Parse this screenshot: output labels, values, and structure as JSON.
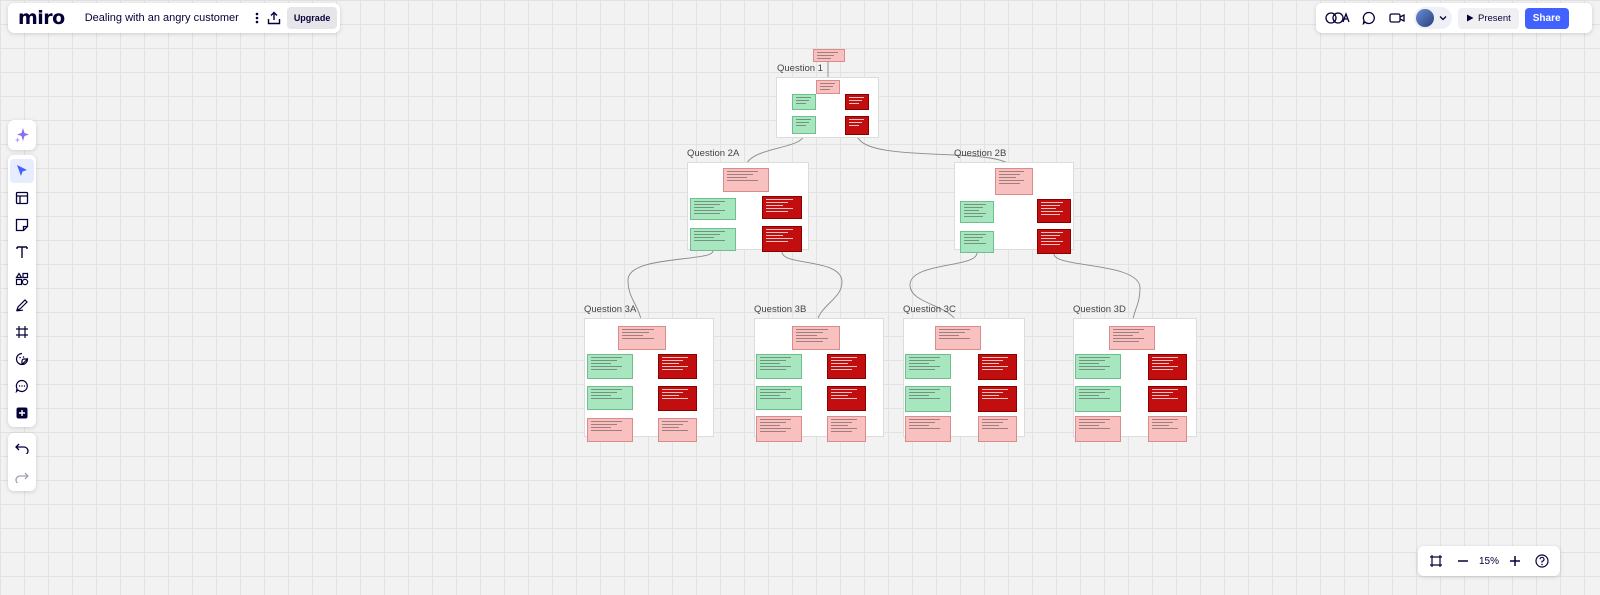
{
  "app": {
    "logo": "miro",
    "board_title": "Dealing with an angry customer",
    "upgrade_label": "Upgrade",
    "present_label": "Present",
    "share_label": "Share",
    "zoom_level": "15%"
  },
  "board": {
    "frames": [
      {
        "label": "Question 1"
      },
      {
        "label": "Question 2A"
      },
      {
        "label": "Question 2B"
      },
      {
        "label": "Question 3A"
      },
      {
        "label": "Question 3B"
      },
      {
        "label": "Question 3C"
      },
      {
        "label": "Question 3D"
      }
    ]
  },
  "icons": {
    "board": "cube-icon",
    "more": "more-vertical-icon",
    "export": "upload-icon",
    "reactions": "reactions-icon",
    "comments": "comment-icon",
    "video": "video-icon",
    "avatar_chevron": "chevron-down-icon",
    "present": "play-icon",
    "ai": "sparkle-icon",
    "tools": [
      "cursor-icon",
      "templates-icon",
      "sticky-note-icon",
      "text-icon",
      "shapes-icon",
      "pen-icon",
      "frame-icon",
      "sticker-icon",
      "comment-icon",
      "add-icon"
    ],
    "undo": "undo-icon",
    "redo": "redo-icon",
    "fit": "fit-screen-icon",
    "zoom_out": "minus-icon",
    "zoom_in": "plus-icon",
    "help": "help-icon"
  },
  "colors": {
    "accent": "#4262ff",
    "brand_text": "#050038",
    "card_pink": "#f9c0c0",
    "card_green": "#a8e6bf",
    "card_red": "#c20e0e"
  }
}
